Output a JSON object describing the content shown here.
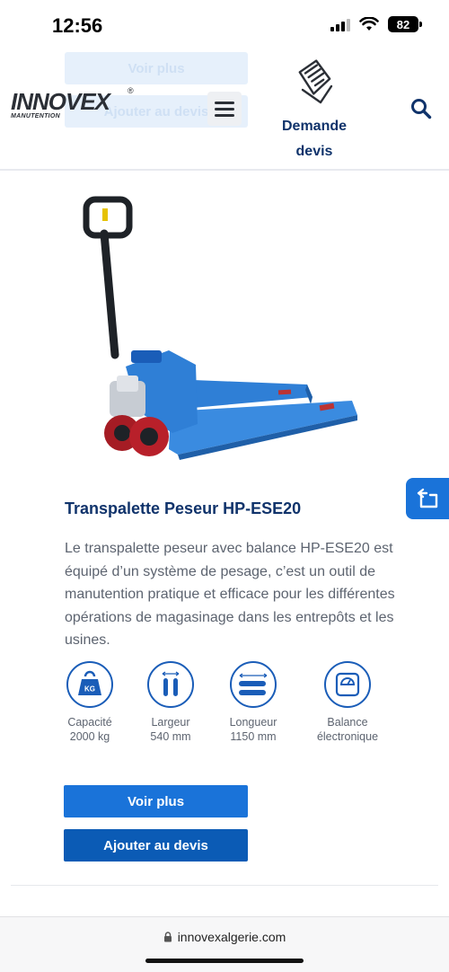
{
  "status_bar": {
    "time": "12:56",
    "battery": "82"
  },
  "header": {
    "ghost_buttons": [
      "Voir plus",
      "Ajouter au devis"
    ],
    "logo_text": "INNOVEX",
    "logo_sub": "MANUTENTION",
    "logo_reg": "®",
    "devis_line1": "Demande",
    "devis_line2": "devis"
  },
  "product": {
    "title": "Transpalette Peseur HP-ESE20",
    "description": "Le transpalette peseur avec balance HP-ESE20 est équipé d’un système de pesage, c’est un outil de manutention pratique et efficace pour les différentes opérations de magasinage dans les entrepôts et les usines.",
    "features": [
      {
        "icon": "kg-weight-icon",
        "line1": "Capacité",
        "line2": "2000 kg"
      },
      {
        "icon": "fork-width-icon",
        "line1": "Largeur",
        "line2": "540 mm"
      },
      {
        "icon": "fork-length-icon",
        "line1": "Longueur",
        "line2": "1150 mm"
      },
      {
        "icon": "scale-icon",
        "line1": "Balance",
        "line2": "électronique"
      }
    ],
    "kg_badge": "KG",
    "voir_plus": "Voir plus",
    "ajouter": "Ajouter au devis"
  },
  "browser": {
    "url": "innovexalgerie.com"
  },
  "colors": {
    "primary": "#1a73d9",
    "secondary": "#0b5bb5",
    "navy": "#10336b",
    "pallet_blue": "#2f7fd6"
  }
}
